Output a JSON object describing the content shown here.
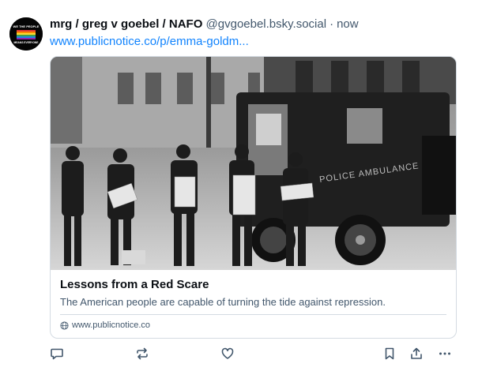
{
  "post": {
    "author": {
      "display_name": "mrg / greg v goebel / NAFO",
      "handle": "@gvgoebel.bsky.social",
      "avatar_text": [
        "WE THE PEOPLE",
        "MEANS EVERYONE"
      ]
    },
    "separator": "·",
    "timestamp": "now",
    "link_text": "www.publicnotice.co/p/emma-goldm...",
    "embed": {
      "image_text": "POLICE AMBULANCE",
      "title": "Lessons from a Red Scare",
      "description": "The American people are capable of turning the tide against repression.",
      "domain": "www.publicnotice.co"
    },
    "actions": [
      "reply-icon",
      "repost-icon",
      "like-icon",
      "bookmark-icon",
      "share-icon",
      "more-icon"
    ]
  },
  "colors": {
    "link": "#1083fe",
    "muted": "#42576c",
    "border": "#d4dbe2",
    "text": "#0b0f14"
  }
}
